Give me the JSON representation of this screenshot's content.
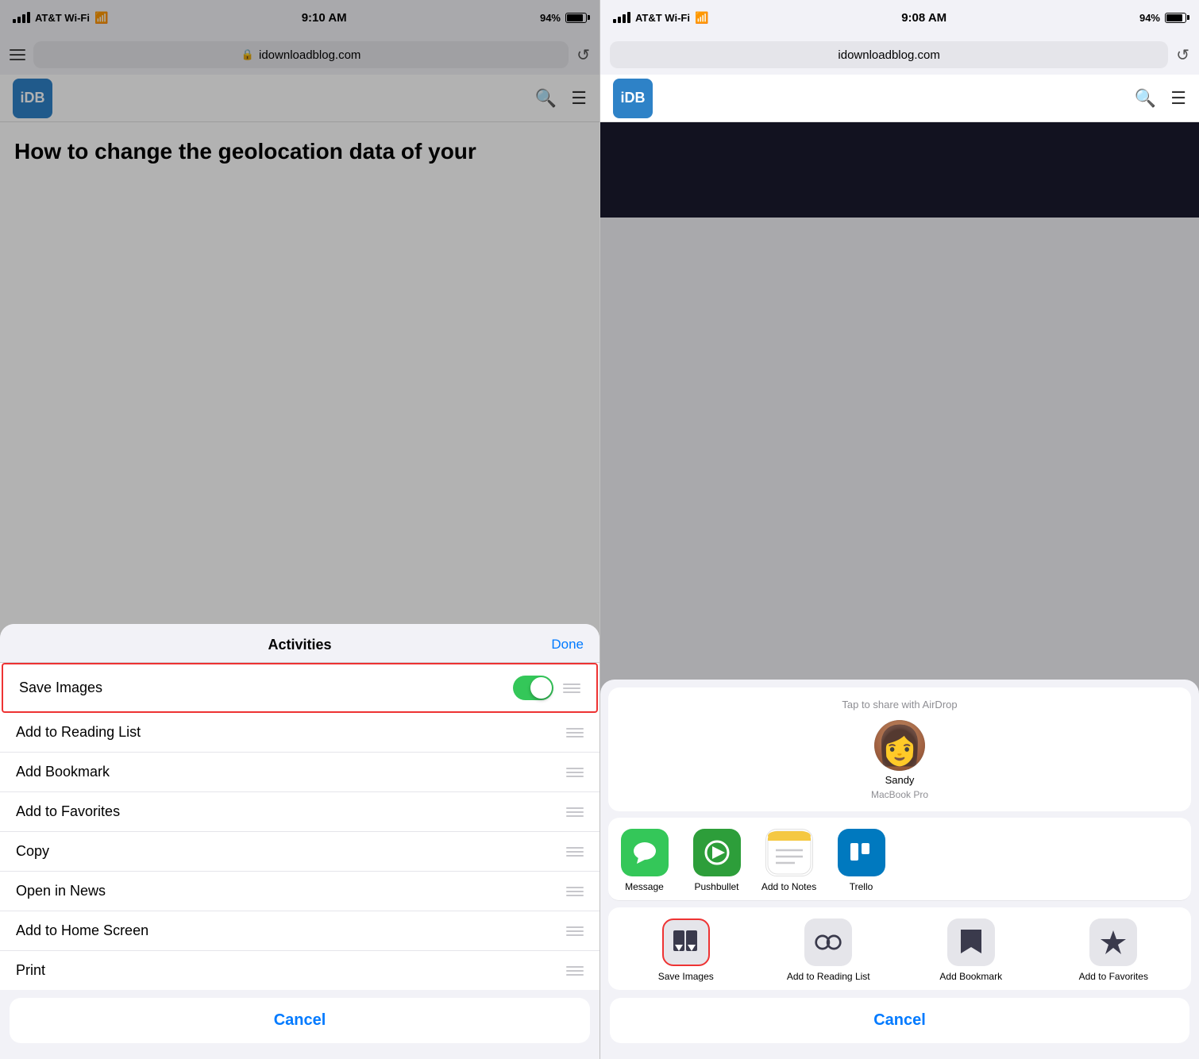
{
  "left_phone": {
    "status": {
      "carrier": "AT&T Wi-Fi",
      "time": "9:10 AM",
      "battery": "94%"
    },
    "address_bar": {
      "url": "idownloadblog.com",
      "lock": "🔒"
    },
    "site": {
      "logo": "iDB",
      "search_icon": "🔍",
      "menu_icon": "☰"
    },
    "article": {
      "title": "How to change the geolocation data of your"
    },
    "modal": {
      "title": "Activities",
      "done_label": "Done",
      "rows": [
        {
          "label": "Save Images",
          "toggle": true,
          "highlighted": true
        },
        {
          "label": "Add to Reading List",
          "toggle": false
        },
        {
          "label": "Add Bookmark",
          "toggle": false
        },
        {
          "label": "Add to Favorites",
          "toggle": false
        },
        {
          "label": "Copy",
          "toggle": false
        },
        {
          "label": "Open in News",
          "toggle": false
        },
        {
          "label": "Add to Home Screen",
          "toggle": false
        },
        {
          "label": "Print",
          "toggle": false
        }
      ],
      "cancel_label": "Cancel"
    }
  },
  "right_phone": {
    "status": {
      "carrier": "AT&T Wi-Fi",
      "time": "9:08 AM",
      "battery": "94%"
    },
    "address_bar": {
      "url": "idownloadblog.com"
    },
    "site": {
      "logo": "iDB",
      "search_icon": "🔍",
      "menu_icon": "☰"
    },
    "share_modal": {
      "airdrop_label": "Tap to share with AirDrop",
      "person": {
        "name": "Sandy",
        "device": "MacBook Pro"
      },
      "apps": [
        {
          "label": "Message",
          "color": "green",
          "icon": "💬"
        },
        {
          "label": "Pushbullet",
          "color": "pushbullet"
        },
        {
          "label": "Add to Notes",
          "color": "notes"
        },
        {
          "label": "Trello",
          "color": "trello"
        }
      ],
      "actions": [
        {
          "label": "Save Images",
          "icon": "⬇",
          "highlighted": true
        },
        {
          "label": "Add to\nReading List",
          "icon": "👓"
        },
        {
          "label": "Add\nBookmark",
          "icon": "📖"
        },
        {
          "label": "Add to\nFavorites",
          "icon": "★"
        }
      ],
      "cancel_label": "Cancel"
    }
  }
}
